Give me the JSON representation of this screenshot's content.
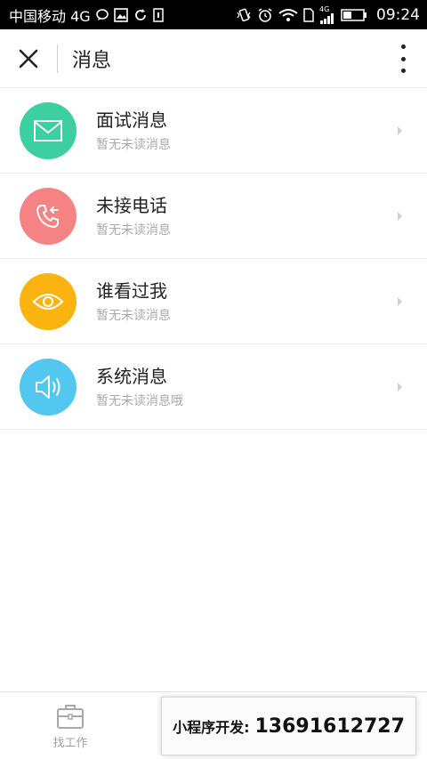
{
  "status_bar": {
    "carrier": "中国移动 4G",
    "signal_type": "4G",
    "time": "09:24",
    "icons": [
      "message-icon",
      "image-icon",
      "sync-icon",
      "sim-icon",
      "vibrate-icon",
      "alarm-icon",
      "wifi-icon",
      "signal-icon",
      "battery-icon"
    ]
  },
  "navbar": {
    "title": "消息"
  },
  "messages": [
    {
      "title": "面试消息",
      "subtitle": "暂无未读消息",
      "icon": "envelope-icon",
      "color": "#3ccf9f"
    },
    {
      "title": "未接电话",
      "subtitle": "暂无未读消息",
      "icon": "phone-missed-icon",
      "color": "#f58383"
    },
    {
      "title": "谁看过我",
      "subtitle": "暂无未读消息",
      "icon": "eye-icon",
      "color": "#fbb30f"
    },
    {
      "title": "系统消息",
      "subtitle": "暂无未读消息哦",
      "icon": "speaker-icon",
      "color": "#52c7ef"
    }
  ],
  "tabbar": {
    "job_label": "找工作"
  },
  "promo": {
    "label": "小程序开发:",
    "phone": "13691612727"
  },
  "colors": {
    "status_bar_bg": "#000000",
    "title_text": "#222222",
    "subtitle_text": "#aaaaaa",
    "divider": "#ededed"
  }
}
